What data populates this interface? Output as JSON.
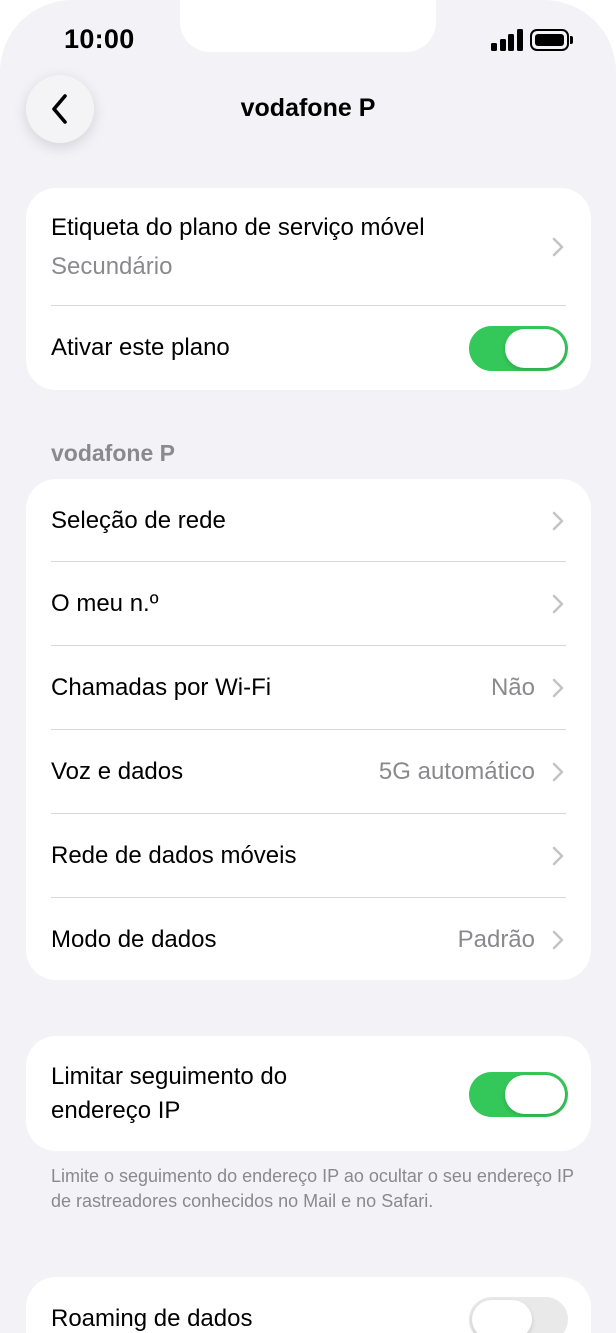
{
  "status_bar": {
    "time": "10:00"
  },
  "nav": {
    "title": "vodafone P",
    "back_icon": "chevron-left-icon"
  },
  "plan_card": {
    "label_row": {
      "title": "Etiqueta do plano de serviço móvel",
      "subtitle": "Secundário"
    },
    "activate_row": {
      "label": "Ativar este plano",
      "enabled": true
    }
  },
  "carrier_section": {
    "header": "vodafone P",
    "rows": [
      {
        "label": "Seleção de rede",
        "value": ""
      },
      {
        "label": "O meu n.º",
        "value": ""
      },
      {
        "label": "Chamadas por Wi-Fi",
        "value": "Não"
      },
      {
        "label": "Voz e dados",
        "value": "5G automático"
      },
      {
        "label": "Rede de dados móveis",
        "value": ""
      },
      {
        "label": "Modo de dados",
        "value": "Padrão"
      }
    ]
  },
  "ip_card": {
    "label_line1": "Limitar seguimento do",
    "label_line2": "endereço IP",
    "enabled": true,
    "footnote": "Limite o seguimento do endereço IP ao ocultar o seu endereço IP de rastreadores conhecidos no Mail e no Safari."
  },
  "roaming_card": {
    "label": "Roaming de dados",
    "enabled": false
  },
  "colors": {
    "toggle_on": "#34c759",
    "toggle_off": "#e9e9ea",
    "background": "#f2f2f7",
    "secondary_text": "#8a8a8e"
  }
}
